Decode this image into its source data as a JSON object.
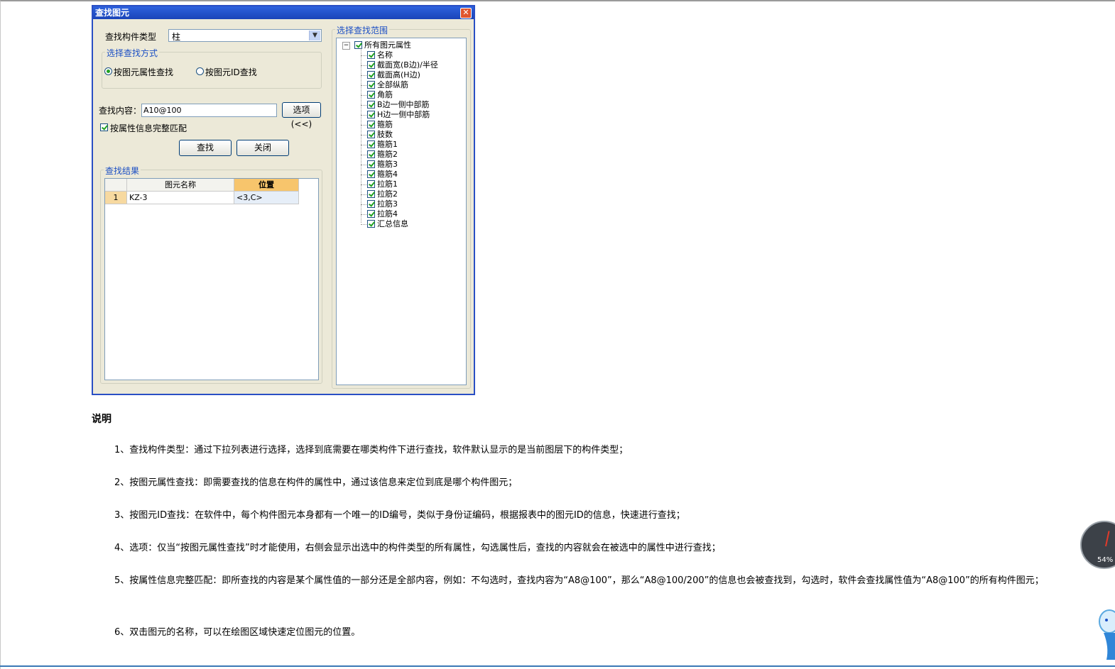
{
  "dialog": {
    "title": "查找图元",
    "component_type_label": "查找构件类型",
    "component_type_value": "柱",
    "search_mode_title": "选择查找方式",
    "radio_attr": "按图元属性查找",
    "radio_id": "按图元ID查找",
    "content_label": "查找内容：",
    "content_value": "A10@100",
    "options_button": "选项(<<)",
    "match_checkbox": "按属性信息完整匹配",
    "find_button": "查找",
    "close_button": "关闭",
    "results_title": "查找结果",
    "results": {
      "headers": [
        "图元名称",
        "位置"
      ],
      "rows": [
        {
          "index": "1",
          "name": "KZ-3",
          "position": "<3,C>"
        }
      ]
    },
    "scope_title": "选择查找范围",
    "scope_root": "所有图元属性",
    "scope_items": [
      "名称",
      "截面宽(B边)/半径",
      "截面高(H边)",
      "全部纵筋",
      "角筋",
      "B边一侧中部筋",
      "H边一侧中部筋",
      "箍筋",
      "肢数",
      "箍筋1",
      "箍筋2",
      "箍筋3",
      "箍筋4",
      "拉筋1",
      "拉筋2",
      "拉筋3",
      "拉筋4",
      "汇总信息"
    ]
  },
  "doc": {
    "heading": "说明",
    "p1": "1、查找构件类型：通过下拉列表进行选择，选择到底需要在哪类构件下进行查找，软件默认显示的是当前图层下的构件类型；",
    "p2": "2、按图元属性查找：即需要查找的信息在构件的属性中，通过该信息来定位到底是哪个构件图元；",
    "p3": "3、按图元ID查找：在软件中，每个构件图元本身都有一个唯一的ID编号，类似于身份证编码，根据报表中的图元ID的信息，快速进行查找；",
    "p4": "4、选项：仅当“按图元属性查找”时才能使用，右侧会显示出选中的构件类型的所有属性，勾选属性后，查找的内容就会在被选中的属性中进行查找；",
    "p5": "5、按属性信息完整匹配：即所查找的内容是某个属性值的一部分还是全部内容，例如：不勾选时，查找内容为“A8@100”，那么“A8@100/200”的信息也会被查找到，勾选时，软件会查找属性值为“A8@100”的所有构件图元；",
    "p6": "6、双击图元的名称，可以在绘图区域快速定位图元的位置。"
  },
  "widget": {
    "gauge_percent": "54%"
  }
}
